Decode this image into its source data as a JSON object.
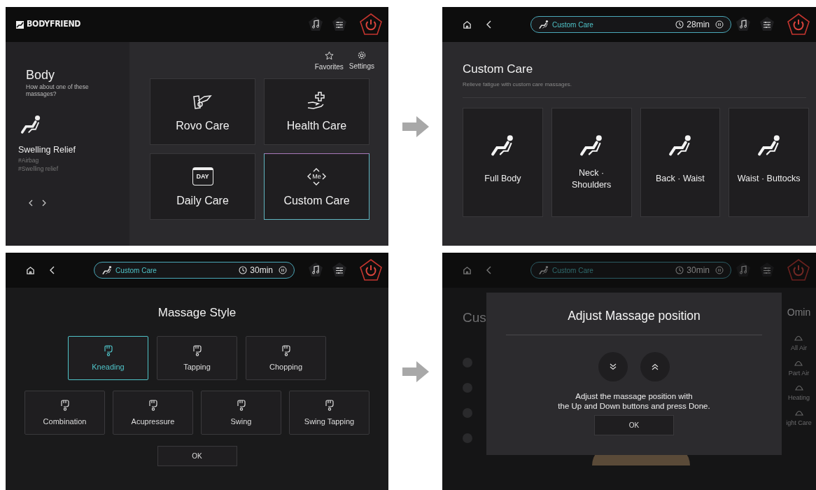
{
  "home_screen": {
    "logo": "BODYFRIEND",
    "section_title": "Body",
    "section_subtitle": "How about one of these massages?",
    "program": {
      "title": "Swelling Relief",
      "tags": [
        "#Airbag",
        "#Swelling relief"
      ]
    },
    "shortcuts": [
      {
        "label": "Favorites",
        "kind": "star"
      },
      {
        "label": "Settings",
        "kind": "gear"
      }
    ],
    "tiles": [
      {
        "label": "Rovo Care",
        "kind": "rovo",
        "selected": false
      },
      {
        "label": "Health Care",
        "kind": "health",
        "selected": false
      },
      {
        "label": "Daily Care",
        "kind": "daily",
        "icon_text": "DAY",
        "selected": false
      },
      {
        "label": "Custom Care",
        "kind": "custom",
        "icon_text": "Me",
        "selected": true
      }
    ]
  },
  "custom_care_screen": {
    "status": {
      "program": "Custom Care",
      "time": "28min"
    },
    "title": "Custom Care",
    "subtitle": "Relieve fatigue with custom care massages.",
    "options": [
      "Full Body",
      "Neck ·\nShoulders",
      "Back · Waist",
      "Waist · Buttocks"
    ]
  },
  "massage_style_screen": {
    "status": {
      "program": "Custom Care",
      "time": "30min"
    },
    "title": "Massage Style",
    "styles": [
      {
        "label": "Kneading",
        "selected": true
      },
      {
        "label": "Tapping",
        "selected": false
      },
      {
        "label": "Chopping",
        "selected": false
      },
      {
        "label": "Combination",
        "selected": false
      },
      {
        "label": "Acupressure",
        "selected": false
      },
      {
        "label": "Swing",
        "selected": false
      },
      {
        "label": "Swing Tapping",
        "selected": false
      }
    ],
    "ok_button": "OK"
  },
  "adjust_position_screen": {
    "status": {
      "program": "Custom Care",
      "time": "30min"
    },
    "background": {
      "title": "Cus",
      "time": "Omin",
      "features": [
        "All Air",
        "Part Air",
        "Heating",
        "ight Care"
      ]
    },
    "dialog": {
      "title": "Adjust Massage position",
      "message": "Adjust the massage position with\nthe Up and Down buttons and press Done.",
      "ok_button": "OK"
    }
  }
}
